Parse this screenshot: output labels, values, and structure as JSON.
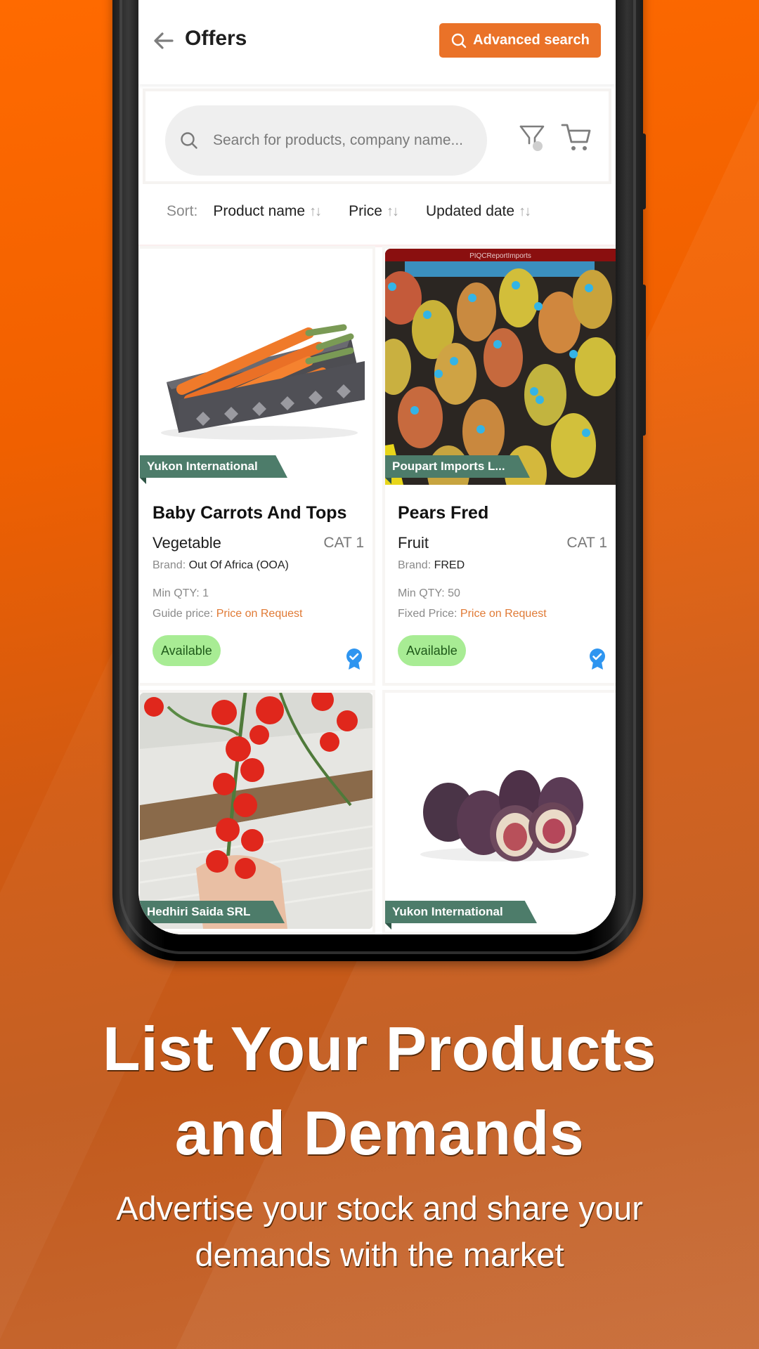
{
  "colors": {
    "accent": "#ea7228",
    "background_orange": "#f06000",
    "tag_green": "#4d7c6a",
    "available_green": "#a8ec94",
    "price_orange": "#e07a35",
    "verified_blue": "#2e95f0"
  },
  "header": {
    "title": "Offers",
    "back_icon": "arrow-left-icon",
    "advanced_search_label": "Advanced search"
  },
  "search": {
    "placeholder": "Search for products, company name...",
    "value": "",
    "filter_icon": "filter-icon",
    "cart_icon": "cart-icon"
  },
  "sort": {
    "label": "Sort:",
    "options": [
      {
        "label": "Product name",
        "icon": "sort-arrows"
      },
      {
        "label": "Price",
        "icon": "sort-arrows"
      },
      {
        "label": "Updated date",
        "icon": "sort-arrows"
      }
    ],
    "arrows": "↑↓"
  },
  "products": [
    {
      "seller": "Yukon International",
      "title": "Baby Carrots And Tops",
      "category": "Vegetable",
      "grade": "CAT 1",
      "brand_label": "Brand:",
      "brand": "Out Of Africa (OOA)",
      "min_qty_label": "Min QTY:",
      "min_qty": "1",
      "price_label": "Guide price:",
      "price": "Price on Request",
      "status": "Available",
      "image": "carrots-in-tray"
    },
    {
      "seller": "Poupart Imports L...",
      "title": "Pears Fred",
      "category": "Fruit",
      "grade": "CAT 1",
      "brand_label": "Brand:",
      "brand": "FRED",
      "min_qty_label": "Min QTY:",
      "min_qty": "50",
      "price_label": "Fixed Price:",
      "price": "Price on Request",
      "status": "Available",
      "image": "pears-in-box",
      "image_caption": "PIQCReportImports"
    },
    {
      "seller": "Hedhiri Saida SRL",
      "image": "cherry-tomatoes-on-vine"
    },
    {
      "seller": "Yukon International",
      "image": "figs"
    }
  ],
  "promo": {
    "headline_line1": "List Your Products",
    "headline_line2": "and Demands",
    "subtitle_line1": "Advertise your stock and share your",
    "subtitle_line2": "demands with the market"
  }
}
